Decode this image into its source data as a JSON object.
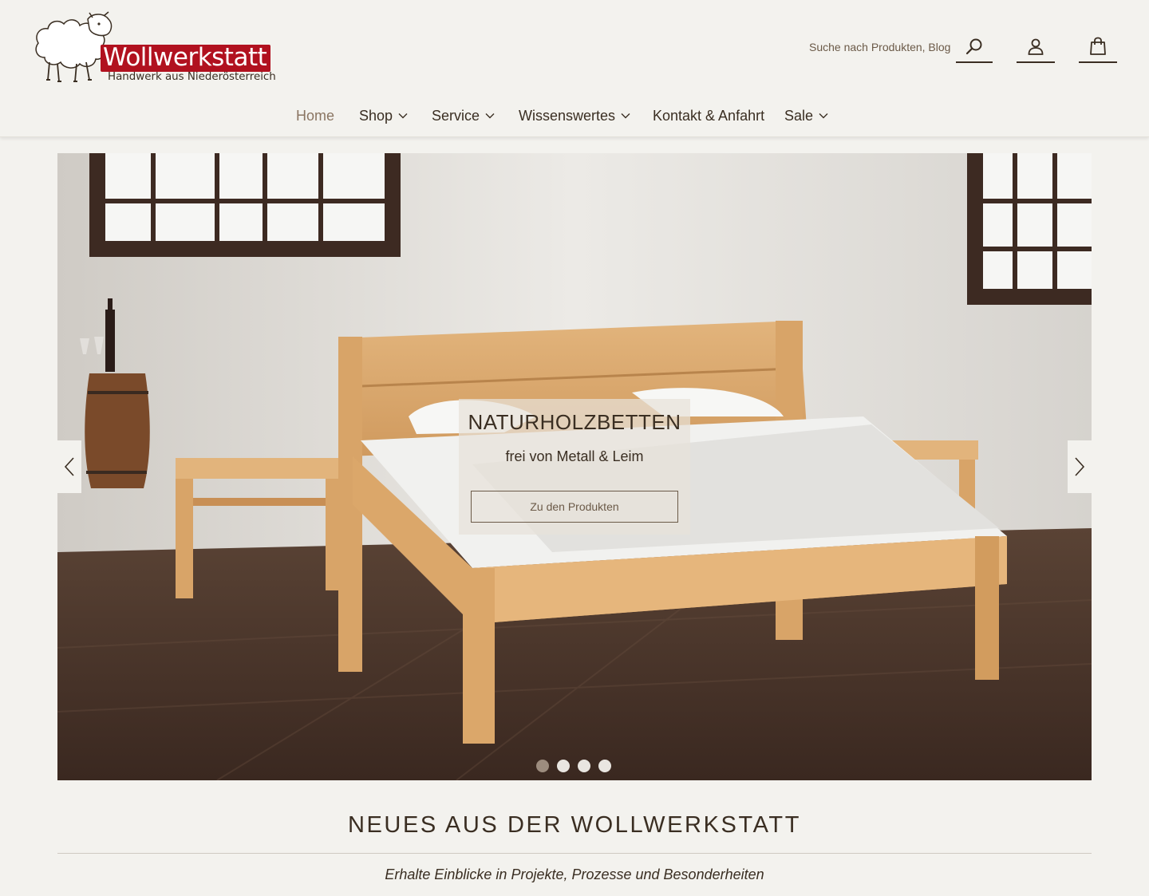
{
  "header": {
    "logo": {
      "title": "Wollwerkstatt",
      "subtitle": "Handwerk aus Niederösterreich",
      "brand_color": "#b1111f"
    },
    "search": {
      "placeholder": "Suche nach Produkten, Blog",
      "icon": "search-icon"
    },
    "account_icon": "user-icon",
    "cart_icon": "shopping-bag-icon"
  },
  "nav": {
    "items": [
      {
        "label": "Home",
        "active": true
      },
      {
        "label": "Shop",
        "dropdown": true
      },
      {
        "label": "Service",
        "dropdown": true
      },
      {
        "label": "Wissenswertes",
        "dropdown": true
      },
      {
        "label": "Kontakt & Anfahrt"
      },
      {
        "label": "Sale",
        "dropdown": true
      }
    ]
  },
  "hero": {
    "slide": {
      "title": "NATURHOLZBETTEN",
      "subtitle": "frei von Metall & Leim",
      "button": "Zu den Produkten"
    },
    "prev_icon": "chevron-left-icon",
    "next_icon": "chevron-right-icon",
    "slides_total": 4,
    "active_slide": 1
  },
  "news": {
    "title": "NEUES AUS DER WOLLWERKSTATT",
    "subtitle": "Erhalte Einblicke in Projekte, Prozesse und Besonderheiten"
  },
  "colors": {
    "background": "#f3f2ee",
    "text": "#3a2e22",
    "nav_active": "#8a7562",
    "dot_active": "#9c8c7e"
  }
}
